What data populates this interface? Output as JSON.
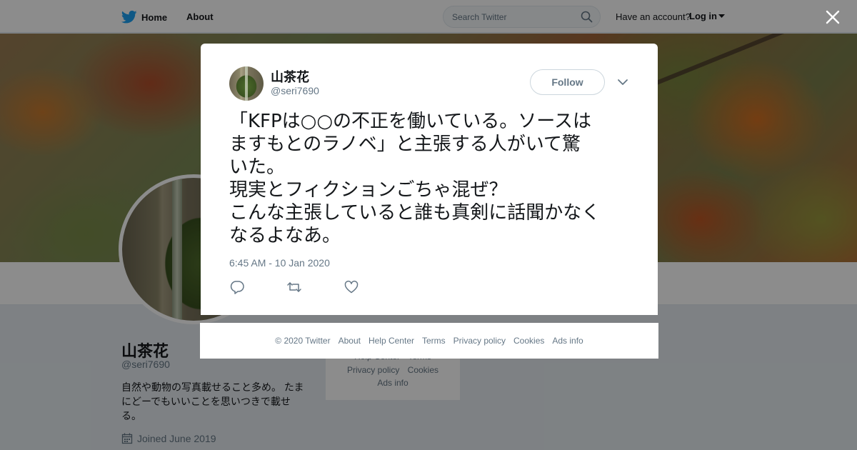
{
  "topbar": {
    "home_label": "Home",
    "about_label": "About",
    "search_placeholder": "Search Twitter",
    "have_account": "Have an account?",
    "login_label": "Log in"
  },
  "profile": {
    "name": "山茶花",
    "handle": "@seri7690",
    "bio_lines": [
      "自然や動物の写真載せること多め。 たま",
      "にどーでもいいことを思いつきで載せ",
      "る。"
    ],
    "joined": "Joined June 2019",
    "footer_rows": [
      [
        "Help Center",
        "Terms"
      ],
      [
        "Privacy policy",
        "Cookies"
      ],
      [
        "Ads info"
      ]
    ]
  },
  "tweet": {
    "author_name": "山茶花",
    "author_handle": "@seri7690",
    "follow_label": "Follow",
    "text_lines": [
      "「KFPは○○の不正を働いている。ソースは",
      "ますもとのラノベ」と主張する人がいて驚",
      "いた。",
      "現実とフィクションごちゃ混ぜ？",
      "こんな主張していると誰も真剣に話聞かなく",
      "なるよなあ。"
    ],
    "timestamp": "6:45 AM - 10 Jan 2020"
  },
  "footer": {
    "copyright": "© 2020 Twitter",
    "links": [
      "About",
      "Help Center",
      "Terms",
      "Privacy policy",
      "Cookies",
      "Ads info"
    ]
  },
  "colors": {
    "twitter_blue": "#1da1f2",
    "text_primary": "#14171a",
    "text_secondary": "#657786",
    "overlay": "rgba(0,0,0,0.45)"
  },
  "icons": {
    "logo": "twitter-bird-icon",
    "search": "search-icon",
    "close": "close-icon",
    "caret": "chevron-down-icon",
    "reply": "reply-icon",
    "retweet": "retweet-icon",
    "like": "heart-icon",
    "calendar": "calendar-icon"
  }
}
